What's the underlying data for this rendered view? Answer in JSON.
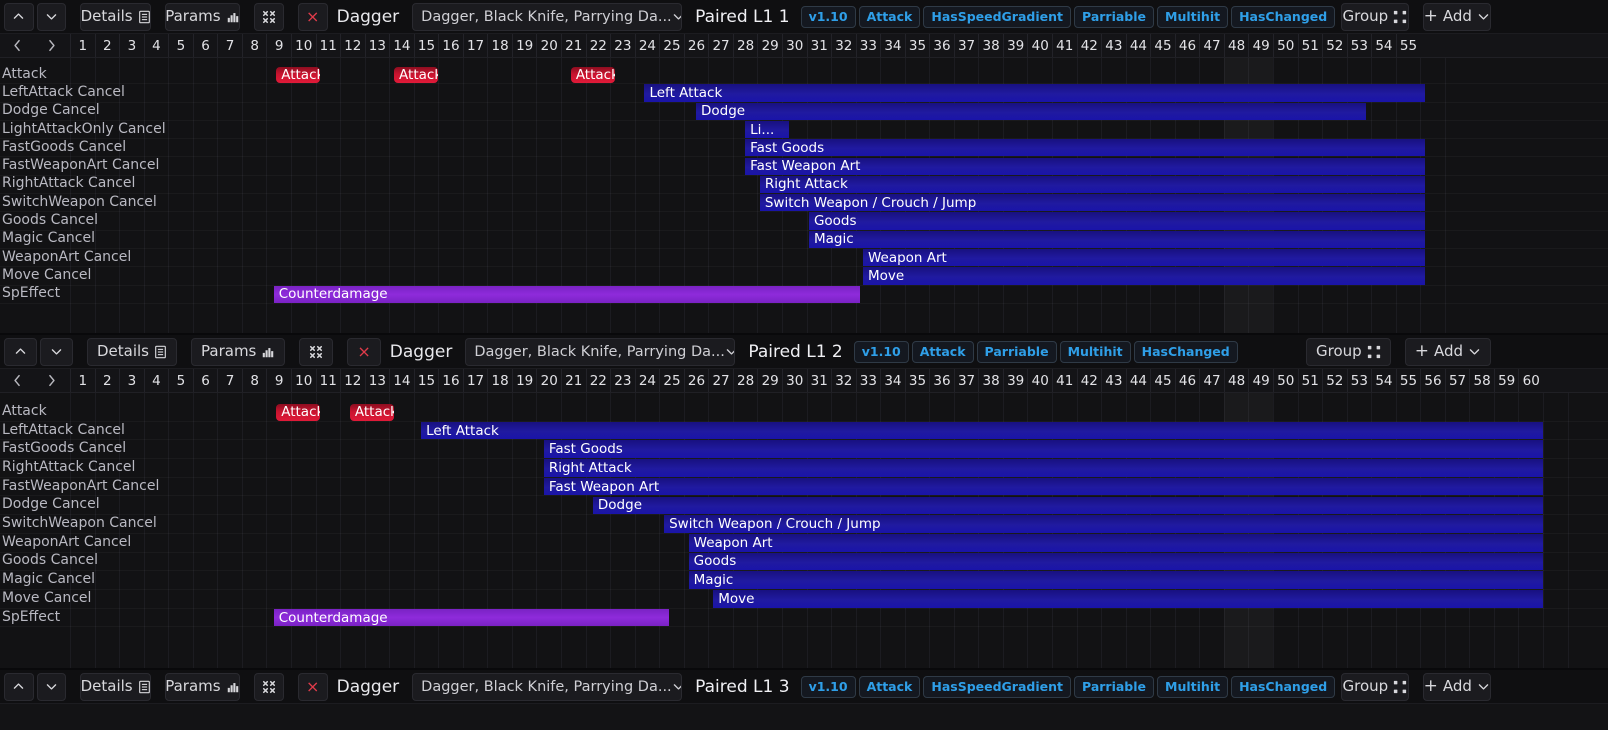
{
  "toolbar_common": {
    "up_icon": "chevron-up-icon",
    "down_icon": "chevron-down-icon",
    "details_label": "Details",
    "details_icon": "list-icon",
    "params_label": "Params",
    "params_icon": "bar-chart-icon",
    "collapse_icon": "collapse-icon",
    "delete_label": "×",
    "weapon_title": "Dagger",
    "weapon_select_value": "Dagger, Black Knife, Parrying Da...",
    "select_caret": "chevron-down-icon",
    "group_label": "Group",
    "group_icon": "group-icon",
    "add_label": "Add",
    "add_plus": "+",
    "add_caret": "chevron-down-icon"
  },
  "panels": [
    {
      "id": "panel-1",
      "anim_name": "Paired L1 1",
      "version": "v1.10",
      "tags": [
        "Attack",
        "HasSpeedGradient",
        "Parriable",
        "Multihit",
        "HasChanged"
      ],
      "ruler": {
        "prev_icon": "chevron-left-icon",
        "next_icon": "chevron-right-icon",
        "first": 1,
        "last": 55
      },
      "rows": [
        {
          "label": "Attack",
          "bars": [
            {
              "text": "Attack",
              "kind": "attack",
              "start": 9.4,
              "end": 11.2
            },
            {
              "text": "Attack",
              "kind": "attack",
              "start": 14.2,
              "end": 16.0
            },
            {
              "text": "Attack",
              "kind": "attack",
              "start": 21.4,
              "end": 23.2
            }
          ]
        },
        {
          "label": "LeftAttack Cancel",
          "bars": [
            {
              "text": "Left Attack",
              "kind": "cancel",
              "start": 24.4,
              "end": 56.2
            }
          ]
        },
        {
          "label": "Dodge Cancel",
          "bars": [
            {
              "text": "Dodge",
              "kind": "cancel",
              "start": 26.5,
              "end": 53.8
            }
          ]
        },
        {
          "label": "LightAttackOnly Cancel",
          "bars": [
            {
              "text": "Li...",
              "kind": "cancel",
              "start": 28.5,
              "end": 30.3
            }
          ]
        },
        {
          "label": "FastGoods Cancel",
          "bars": [
            {
              "text": "Fast Goods",
              "kind": "cancel",
              "start": 28.5,
              "end": 56.2
            }
          ]
        },
        {
          "label": "FastWeaponArt Cancel",
          "bars": [
            {
              "text": "Fast Weapon Art",
              "kind": "cancel",
              "start": 28.5,
              "end": 56.2
            }
          ]
        },
        {
          "label": "RightAttack Cancel",
          "bars": [
            {
              "text": "Right Attack",
              "kind": "cancel",
              "start": 29.1,
              "end": 56.2
            }
          ]
        },
        {
          "label": "SwitchWeapon Cancel",
          "bars": [
            {
              "text": "Switch Weapon / Crouch / Jump",
              "kind": "cancel",
              "start": 29.1,
              "end": 56.2
            }
          ]
        },
        {
          "label": "Goods Cancel",
          "bars": [
            {
              "text": "Goods",
              "kind": "cancel",
              "start": 31.1,
              "end": 56.2
            }
          ]
        },
        {
          "label": "Magic Cancel",
          "bars": [
            {
              "text": "Magic",
              "kind": "cancel",
              "start": 31.1,
              "end": 56.2
            }
          ]
        },
        {
          "label": "WeaponArt Cancel",
          "bars": [
            {
              "text": "Weapon Art",
              "kind": "cancel",
              "start": 33.3,
              "end": 56.2
            }
          ]
        },
        {
          "label": "Move Cancel",
          "bars": [
            {
              "text": "Move",
              "kind": "cancel",
              "start": 33.3,
              "end": 56.2
            }
          ]
        },
        {
          "label": "SpEffect",
          "bars": [
            {
              "text": "Counterdamage",
              "kind": "sp",
              "start": 9.3,
              "end": 33.2
            }
          ]
        }
      ]
    },
    {
      "id": "panel-2",
      "anim_name": "Paired L1 2",
      "version": "v1.10",
      "tags": [
        "Attack",
        "Parriable",
        "Multihit",
        "HasChanged"
      ],
      "ruler": {
        "prev_icon": "chevron-left-icon",
        "next_icon": "chevron-right-icon",
        "first": 1,
        "last": 60
      },
      "rows": [
        {
          "label": "Attack",
          "bars": [
            {
              "text": "Attack",
              "kind": "attack",
              "start": 9.4,
              "end": 11.2
            },
            {
              "text": "Attack",
              "kind": "attack",
              "start": 12.4,
              "end": 14.2
            }
          ]
        },
        {
          "label": "LeftAttack Cancel",
          "bars": [
            {
              "text": "Left Attack",
              "kind": "cancel",
              "start": 15.3,
              "end": 61.0
            }
          ]
        },
        {
          "label": "FastGoods Cancel",
          "bars": [
            {
              "text": "Fast Goods",
              "kind": "cancel",
              "start": 20.3,
              "end": 61.0
            }
          ]
        },
        {
          "label": "RightAttack Cancel",
          "bars": [
            {
              "text": "Right Attack",
              "kind": "cancel",
              "start": 20.3,
              "end": 61.0
            }
          ]
        },
        {
          "label": "FastWeaponArt Cancel",
          "bars": [
            {
              "text": "Fast Weapon Art",
              "kind": "cancel",
              "start": 20.3,
              "end": 61.0
            }
          ]
        },
        {
          "label": "Dodge Cancel",
          "bars": [
            {
              "text": "Dodge",
              "kind": "cancel",
              "start": 22.3,
              "end": 61.0
            }
          ]
        },
        {
          "label": "SwitchWeapon Cancel",
          "bars": [
            {
              "text": "Switch Weapon / Crouch / Jump",
              "kind": "cancel",
              "start": 25.2,
              "end": 61.0
            }
          ]
        },
        {
          "label": "WeaponArt Cancel",
          "bars": [
            {
              "text": "Weapon Art",
              "kind": "cancel",
              "start": 26.2,
              "end": 61.0
            }
          ]
        },
        {
          "label": "Goods Cancel",
          "bars": [
            {
              "text": "Goods",
              "kind": "cancel",
              "start": 26.2,
              "end": 61.0
            }
          ]
        },
        {
          "label": "Magic Cancel",
          "bars": [
            {
              "text": "Magic",
              "kind": "cancel",
              "start": 26.2,
              "end": 61.0
            }
          ]
        },
        {
          "label": "Move Cancel",
          "bars": [
            {
              "text": "Move",
              "kind": "cancel",
              "start": 27.2,
              "end": 61.0
            }
          ]
        },
        {
          "label": "SpEffect",
          "bars": [
            {
              "text": "Counterdamage",
              "kind": "sp",
              "start": 9.3,
              "end": 25.4
            }
          ]
        }
      ]
    },
    {
      "id": "panel-3",
      "anim_name": "Paired L1 3",
      "version": "v1.10",
      "tags": [
        "Attack",
        "HasSpeedGradient",
        "Parriable",
        "Multihit",
        "HasChanged"
      ],
      "ruler": null,
      "rows": []
    }
  ]
}
